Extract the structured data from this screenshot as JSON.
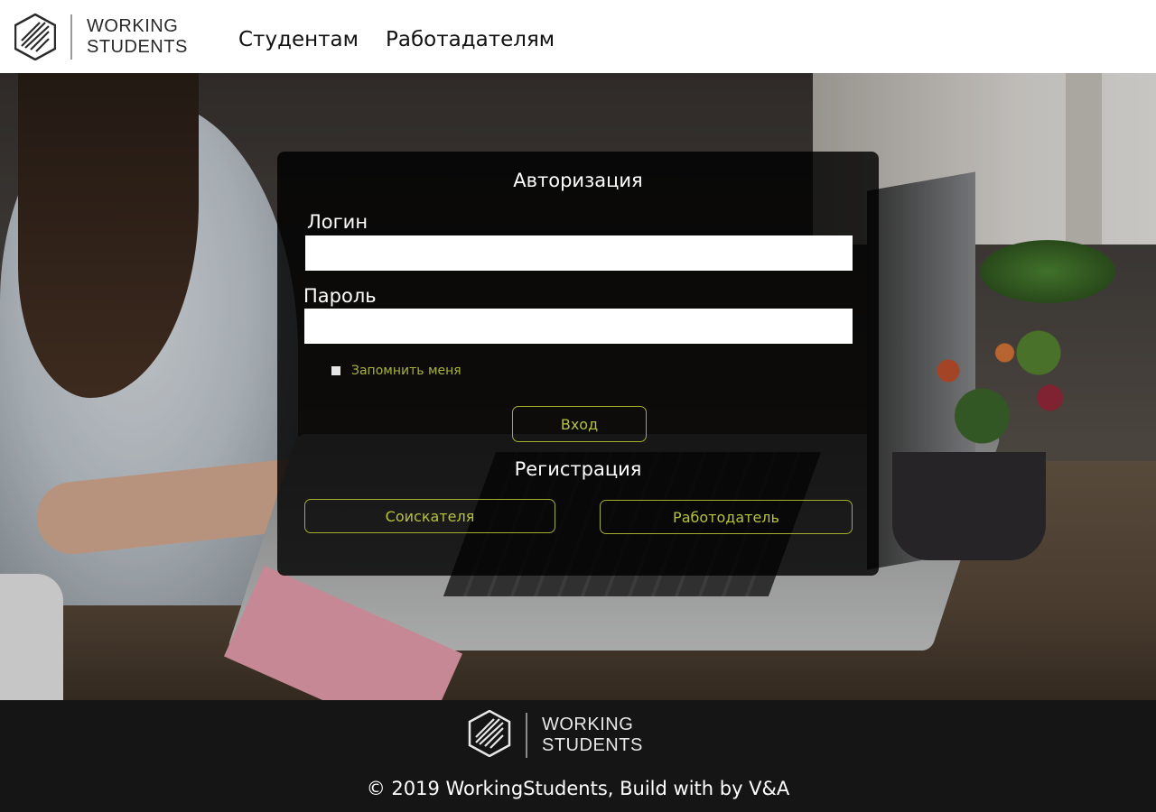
{
  "header": {
    "logo": {
      "line1": "WORKING",
      "line2": "STUDENTS"
    },
    "nav": [
      {
        "label": "Студентам"
      },
      {
        "label": "Работадателям"
      }
    ]
  },
  "login": {
    "title": "Авторизация",
    "login_label": "Логин",
    "login_value": "",
    "password_label": "Пароль",
    "password_value": "",
    "remember_label": "Запомнить меня",
    "remember_checked": false,
    "submit_label": "Вход",
    "registration_title": "Регистрация",
    "register_seeker_label": "Соискателя",
    "register_employer_label": "Работодатель"
  },
  "footer": {
    "logo": {
      "line1": "WORKING",
      "line2": "STUDENTS"
    },
    "copyright": "© 2019 WorkingStudents, Build with by V&A"
  },
  "colors": {
    "accent": "#a3ae2c",
    "panel_bg": "rgba(0,0,0,0.82)",
    "footer_bg": "#151515",
    "header_bg": "#ffffff"
  }
}
